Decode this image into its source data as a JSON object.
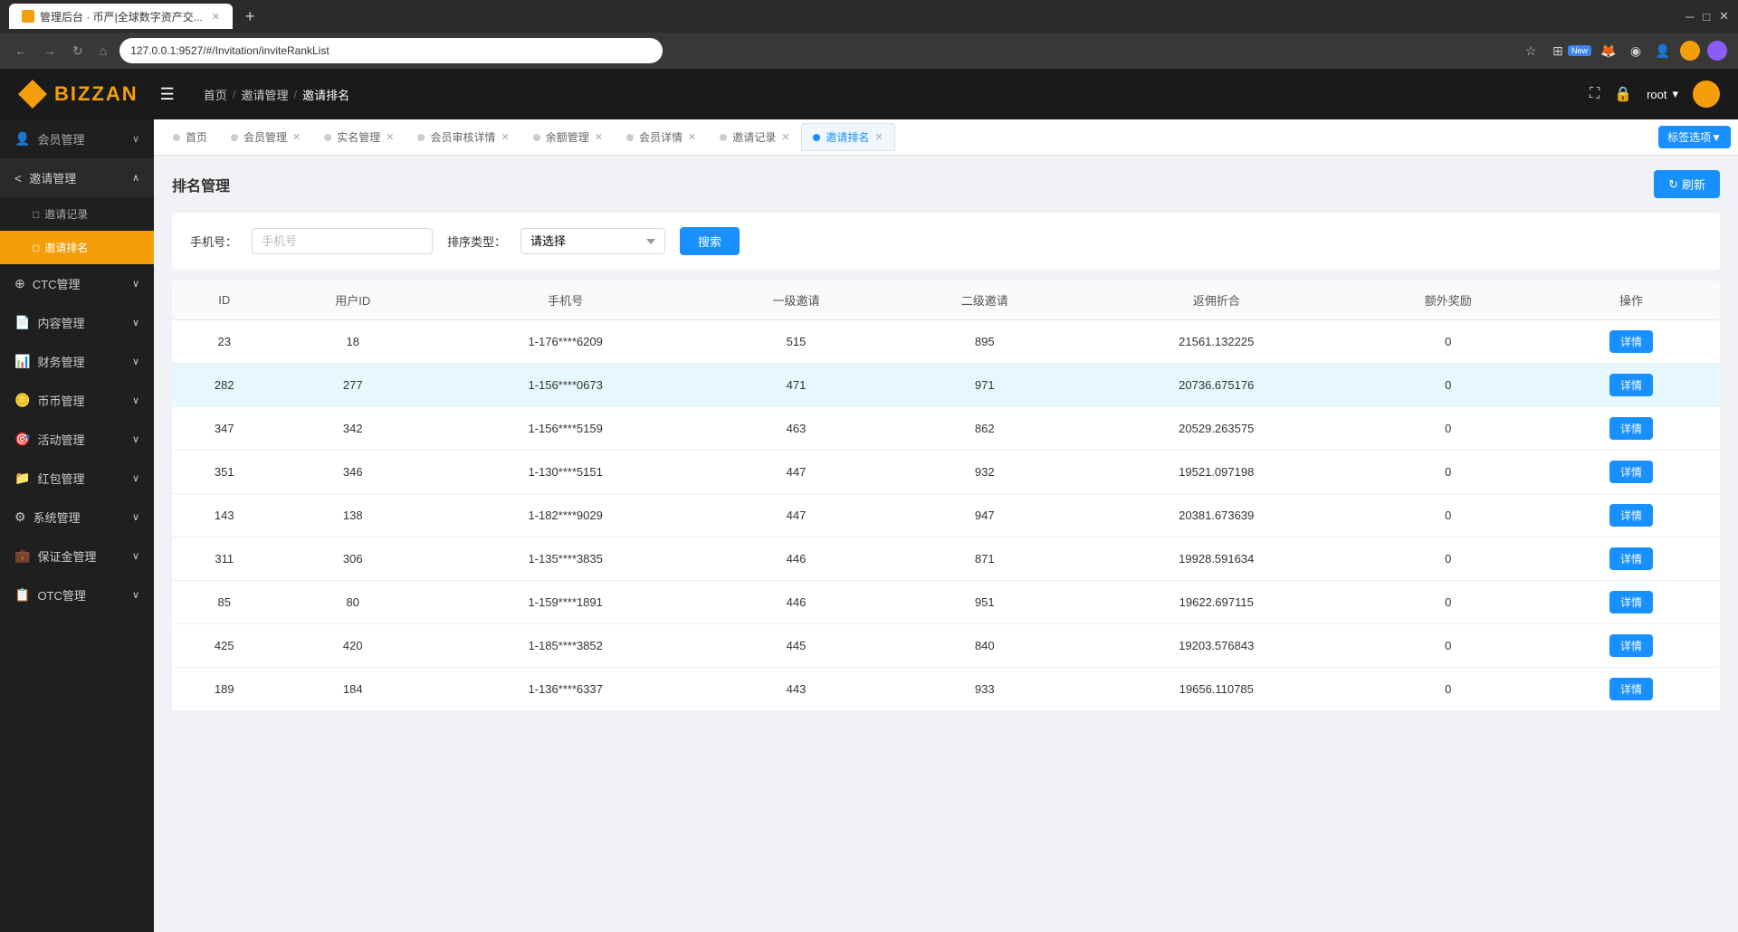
{
  "browser": {
    "tab_title": "管理后台 · 币严|全球数字资产交...",
    "address": "127.0.0.1:9527/#/Invitation/inviteRankList",
    "new_badge": "New"
  },
  "topnav": {
    "logo_text": "BIZZAN",
    "breadcrumb": [
      "首页",
      "邀请管理",
      "邀请排名"
    ],
    "user": "root",
    "fullscreen_title": "全屏",
    "lock_title": "锁定"
  },
  "sidebar": {
    "items": [
      {
        "id": "member",
        "icon": "👤",
        "label": "会员管理",
        "arrow": "∨"
      },
      {
        "id": "invite",
        "icon": "<",
        "label": "邀请管理",
        "arrow": "∧",
        "active": true
      },
      {
        "id": "invite-record",
        "sub": true,
        "icon": "□",
        "label": "邀请记录"
      },
      {
        "id": "invite-rank",
        "sub": true,
        "icon": "□",
        "label": "邀请排名",
        "active": true
      },
      {
        "id": "ctc",
        "icon": "⊕",
        "label": "CTC管理",
        "arrow": "∨"
      },
      {
        "id": "content",
        "icon": "📄",
        "label": "内容管理",
        "arrow": "∨"
      },
      {
        "id": "finance",
        "icon": "📊",
        "label": "财务管理",
        "arrow": "∨"
      },
      {
        "id": "coin",
        "icon": "🪙",
        "label": "币币管理",
        "arrow": "∨"
      },
      {
        "id": "activity",
        "icon": "🎯",
        "label": "活动管理",
        "arrow": "∨"
      },
      {
        "id": "redpacket",
        "icon": "📁",
        "label": "红包管理",
        "arrow": "∨"
      },
      {
        "id": "system",
        "icon": "⚙",
        "label": "系统管理",
        "arrow": "∨"
      },
      {
        "id": "margin",
        "icon": "💼",
        "label": "保证金管理",
        "arrow": "∨"
      },
      {
        "id": "otc",
        "icon": "📋",
        "label": "OTC管理",
        "arrow": "∨"
      }
    ]
  },
  "tabs": [
    {
      "id": "home",
      "label": "首页",
      "closable": false,
      "active": false
    },
    {
      "id": "member",
      "label": "会员管理",
      "closable": true,
      "active": false
    },
    {
      "id": "realname",
      "label": "实名管理",
      "closable": true,
      "active": false
    },
    {
      "id": "member-review",
      "label": "会员审核详情",
      "closable": true,
      "active": false
    },
    {
      "id": "balance",
      "label": "余额管理",
      "closable": true,
      "active": false
    },
    {
      "id": "member-detail",
      "label": "会员详情",
      "closable": true,
      "active": false
    },
    {
      "id": "invite-record",
      "label": "邀请记录",
      "closable": true,
      "active": false
    },
    {
      "id": "invite-rank",
      "label": "邀请排名",
      "closable": true,
      "active": true
    }
  ],
  "tags_btn": "标签选项▼",
  "page": {
    "title": "排名管理",
    "refresh_btn": "刷新"
  },
  "search": {
    "phone_label": "手机号：",
    "phone_placeholder": "手机号",
    "sort_label": "排序类型：",
    "sort_placeholder": "请选择",
    "search_btn": "搜索"
  },
  "table": {
    "columns": [
      "ID",
      "用户ID",
      "手机号",
      "一级邀请",
      "二级邀请",
      "返佣折合",
      "额外奖励",
      "操作"
    ],
    "rows": [
      {
        "id": "23",
        "user_id": "18",
        "phone": "1-176****6209",
        "level1": "515",
        "level2": "895",
        "rebate": "21561.132225",
        "bonus": "0",
        "highlighted": false
      },
      {
        "id": "282",
        "user_id": "277",
        "phone": "1-156****0673",
        "level1": "471",
        "level2": "971",
        "rebate": "20736.675176",
        "bonus": "0",
        "highlighted": true
      },
      {
        "id": "347",
        "user_id": "342",
        "phone": "1-156****5159",
        "level1": "463",
        "level2": "862",
        "rebate": "20529.263575",
        "bonus": "0",
        "highlighted": false
      },
      {
        "id": "351",
        "user_id": "346",
        "phone": "1-130****5151",
        "level1": "447",
        "level2": "932",
        "rebate": "19521.097198",
        "bonus": "0",
        "highlighted": false
      },
      {
        "id": "143",
        "user_id": "138",
        "phone": "1-182****9029",
        "level1": "447",
        "level2": "947",
        "rebate": "20381.673639",
        "bonus": "0",
        "highlighted": false
      },
      {
        "id": "311",
        "user_id": "306",
        "phone": "1-135****3835",
        "level1": "446",
        "level2": "871",
        "rebate": "19928.591634",
        "bonus": "0",
        "highlighted": false
      },
      {
        "id": "85",
        "user_id": "80",
        "phone": "1-159****1891",
        "level1": "446",
        "level2": "951",
        "rebate": "19622.697115",
        "bonus": "0",
        "highlighted": false
      },
      {
        "id": "425",
        "user_id": "420",
        "phone": "1-185****3852",
        "level1": "445",
        "level2": "840",
        "rebate": "19203.576843",
        "bonus": "0",
        "highlighted": false
      },
      {
        "id": "189",
        "user_id": "184",
        "phone": "1-136****6337",
        "level1": "443",
        "level2": "933",
        "rebate": "19656.110785",
        "bonus": "0",
        "highlighted": false
      }
    ],
    "detail_btn": "详情"
  }
}
